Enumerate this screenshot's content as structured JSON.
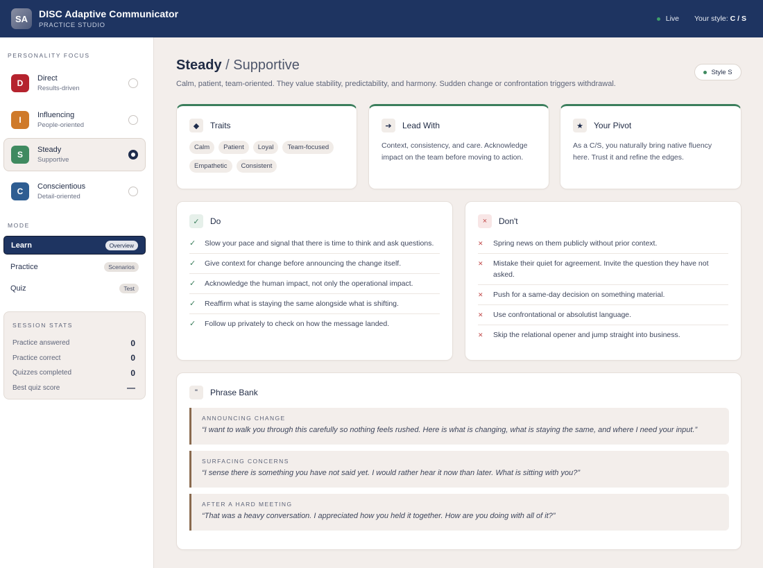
{
  "header": {
    "logo_initials": "SA",
    "title": "DISC Adaptive Communicator",
    "subtitle": "PRACTICE STUDIO",
    "live_label": "Live",
    "your_style_label": "Your style:",
    "your_style_value": "C / S"
  },
  "sidebar": {
    "personality_focus_label": "PERSONALITY FOCUS",
    "personas": [
      {
        "letter": "D",
        "name": "Direct",
        "sub": "Results-driven",
        "color": "#b5232e",
        "selected": false
      },
      {
        "letter": "I",
        "name": "Influencing",
        "sub": "People-oriented",
        "color": "#cf7a2a",
        "selected": false
      },
      {
        "letter": "S",
        "name": "Steady",
        "sub": "Supportive",
        "color": "#3f8a60",
        "selected": true
      },
      {
        "letter": "C",
        "name": "Conscientious",
        "sub": "Detail-oriented",
        "color": "#2e5d92",
        "selected": false
      }
    ],
    "mode_label": "MODE",
    "modes": [
      {
        "label": "Learn",
        "pill": "Overview",
        "active": true
      },
      {
        "label": "Practice",
        "pill": "Scenarios",
        "active": false
      },
      {
        "label": "Quiz",
        "pill": "Test",
        "active": false
      }
    ],
    "stats": {
      "label": "SESSION STATS",
      "rows": [
        {
          "label": "Practice answered",
          "value": "0"
        },
        {
          "label": "Practice correct",
          "value": "0"
        },
        {
          "label": "Quizzes completed",
          "value": "0"
        },
        {
          "label": "Best quiz score",
          "value": "—"
        }
      ]
    }
  },
  "main": {
    "title_bold": "Steady",
    "title_slash": "/",
    "title_sub": "Supportive",
    "description": "Calm, patient, team-oriented. They value stability, predictability, and harmony. Sudden change or confrontation triggers withdrawal.",
    "style_chip": "Style S",
    "traits": {
      "title": "Traits",
      "icon": "diamond-icon",
      "tags": [
        "Calm",
        "Patient",
        "Loyal",
        "Team-focused",
        "Empathetic",
        "Consistent"
      ]
    },
    "lead_with": {
      "title": "Lead With",
      "icon": "arrow-right-icon",
      "text": "Context, consistency, and care. Acknowledge impact on the team before moving to action."
    },
    "your_pivot": {
      "title": "Your Pivot",
      "icon": "star-icon",
      "text": "As a C/S, you naturally bring native fluency here. Trust it and refine the edges."
    },
    "do": {
      "title": "Do",
      "items": [
        "Slow your pace and signal that there is time to think and ask questions.",
        "Give context for change before announcing the change itself.",
        "Acknowledge the human impact, not only the operational impact.",
        "Reaffirm what is staying the same alongside what is shifting.",
        "Follow up privately to check on how the message landed."
      ]
    },
    "dont": {
      "title": "Don't",
      "items": [
        "Spring news on them publicly without prior context.",
        "Mistake their quiet for agreement. Invite the question they have not asked.",
        "Push for a same-day decision on something material.",
        "Use confrontational or absolutist language.",
        "Skip the relational opener and jump straight into business."
      ]
    },
    "phrase_bank": {
      "title": "Phrase Bank",
      "icon_glyph": "\"",
      "phrases": [
        {
          "label": "ANNOUNCING CHANGE",
          "quote": "“I want to walk you through this carefully so nothing feels rushed. Here is what is changing, what is staying the same, and where I need your input.”"
        },
        {
          "label": "SURFACING CONCERNS",
          "quote": "“I sense there is something you have not said yet. I would rather hear it now than later. What is sitting with you?”"
        },
        {
          "label": "AFTER A HARD MEETING",
          "quote": "“That was a heavy conversation. I appreciated how you held it together. How are you doing with all of it?”"
        }
      ]
    }
  }
}
